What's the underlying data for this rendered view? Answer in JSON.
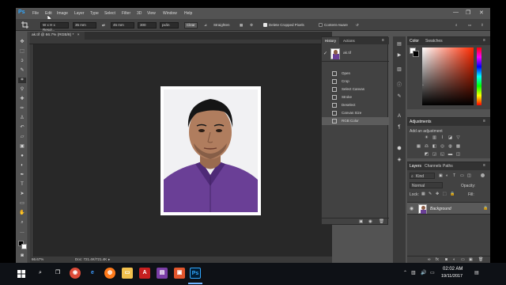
{
  "app": {
    "logo": "Ps",
    "menus": [
      "File",
      "Edit",
      "Image",
      "Layer",
      "Type",
      "Select",
      "Filter",
      "3D",
      "View",
      "Window",
      "Help"
    ],
    "window_controls": [
      "—",
      "❐",
      "✕"
    ]
  },
  "options_bar": {
    "ratio": "W x H x Resol...",
    "width": "35 mm",
    "height": "45 mm",
    "resolution": "300",
    "units": "px/in",
    "clear": "Clear",
    "straighten": "Straighten",
    "delete_cropped": "Delete Cropped Pixels",
    "content_aware": "Content-Aware"
  },
  "document": {
    "tab_title": "ak.tif @ 66.7% (RGB/8) *",
    "zoom": "66.67%",
    "doc_info": "Doc: 721.4K/721.4K"
  },
  "history_panel": {
    "tabs": [
      "History",
      "Actions"
    ],
    "snapshot": "ak.tif",
    "items": [
      "Open",
      "Crop",
      "Select Canvas",
      "Stroke",
      "Deselect",
      "Canvas Size",
      "RGB Color"
    ],
    "selected_item": "RGB Color"
  },
  "color_panel": {
    "tabs": [
      "Color",
      "Swatches"
    ],
    "accent": "#ff2a00"
  },
  "adjustments_panel": {
    "title": "Adjustments",
    "subtitle": "Add an adjustment"
  },
  "layers_panel": {
    "tabs": [
      "Layers",
      "Channels",
      "Paths"
    ],
    "kind_label": "Kind",
    "blend_mode": "Normal",
    "opacity_label": "Opacity:",
    "lock_label": "Lock:",
    "fill_label": "Fill:",
    "layer_name": "Background"
  },
  "taskbar": {
    "time": "02:02 AM",
    "date": "19/11/2017",
    "apps": [
      "start",
      "search",
      "task-view",
      "chrome",
      "edge",
      "firefox",
      "explorer",
      "acrobat",
      "winrar",
      "store",
      "photoshop"
    ]
  }
}
